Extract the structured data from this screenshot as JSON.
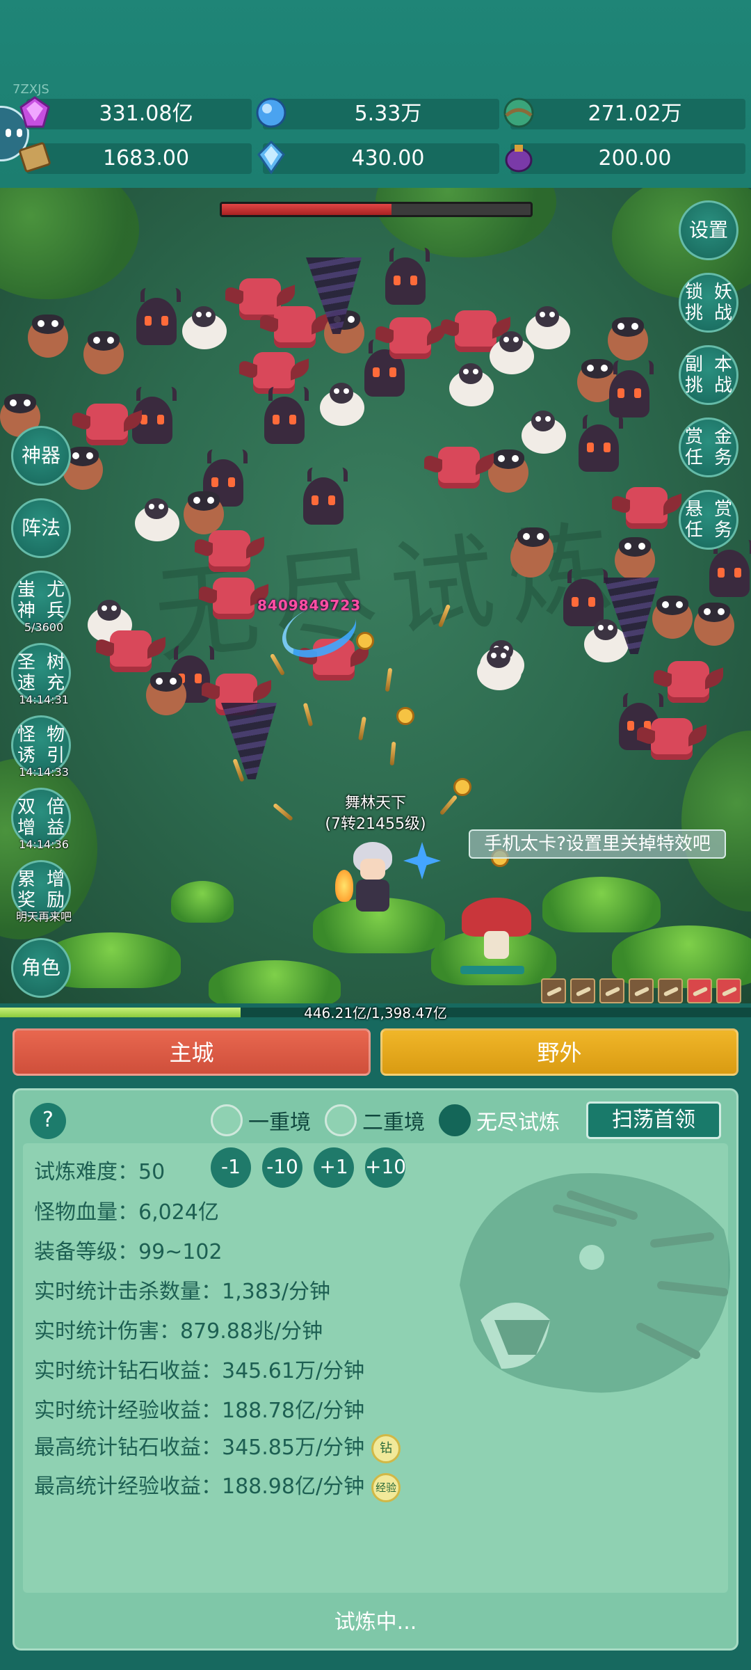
{
  "watermark": "7ZXJS",
  "resources": [
    {
      "icon": "gem-icon",
      "value": "331.08亿"
    },
    {
      "icon": "crystal-icon",
      "value": "5.33万"
    },
    {
      "icon": "orb-icon",
      "value": "271.02万"
    },
    {
      "icon": "book-icon",
      "value": "1683.00"
    },
    {
      "icon": "ice-crystal-icon",
      "value": "430.00"
    },
    {
      "icon": "potion-icon",
      "value": "200.00"
    }
  ],
  "battle": {
    "background_text": "无尽试炼",
    "boss_hp_fraction": 0.55,
    "damage_number": "8409849723",
    "hero_name": "舞林天下",
    "hero_level": "(7转21455级)",
    "tip": "手机太卡?设置里关掉特效吧",
    "xp_text": "446.21亿/1,398.47亿",
    "xp_fraction": 0.32
  },
  "left_buttons": [
    {
      "label": "神器"
    },
    {
      "label": "阵法"
    },
    {
      "col1": "蚩神",
      "col2": "尤兵",
      "sub": "5/3600"
    },
    {
      "col1": "圣速",
      "col2": "树充",
      "sub": "14:14:31"
    },
    {
      "col1": "怪诱",
      "col2": "物引",
      "sub": "14:14:33"
    },
    {
      "col1": "双增",
      "col2": "倍益",
      "sub": "14:14:36"
    },
    {
      "col1": "累奖",
      "col2": "增励",
      "sub": "明天再来吧"
    },
    {
      "label": "角色"
    }
  ],
  "right_buttons": [
    {
      "label": "设置"
    },
    {
      "col1": "锁挑",
      "col2": "妖战"
    },
    {
      "col1": "副挑",
      "col2": "本战"
    },
    {
      "col1": "赏任",
      "col2": "金务"
    },
    {
      "col1": "悬任",
      "col2": "赏务"
    }
  ],
  "tabs": {
    "city": "主城",
    "wild": "野外"
  },
  "panel": {
    "help": "?",
    "modes": [
      "一重境",
      "二重境",
      "无尽试炼"
    ],
    "selected_mode": "无尽试炼",
    "sweep": "扫荡首领",
    "difficulty_label": "试炼难度：",
    "difficulty_value": "50",
    "adjust": [
      "-1",
      "-10",
      "+1",
      "+10"
    ],
    "stats": [
      {
        "label": "怪物血量：",
        "value": "6,024亿"
      },
      {
        "label": "装备等级：",
        "value": "99~102"
      },
      {
        "label": "实时统计击杀数量：",
        "value": "1,383/分钟"
      },
      {
        "label": "实时统计伤害：",
        "value": "879.88兆/分钟"
      },
      {
        "label": "实时统计钻石收益：",
        "value": "345.61万/分钟"
      },
      {
        "label": "实时统计经验收益：",
        "value": "188.78亿/分钟"
      },
      {
        "label": "最高统计钻石收益：",
        "value": "345.85万/分钟",
        "badge": "钻"
      },
      {
        "label": "最高统计经验收益：",
        "value": "188.98亿/分钟",
        "badge": "经验"
      }
    ],
    "status": "试炼中..."
  }
}
